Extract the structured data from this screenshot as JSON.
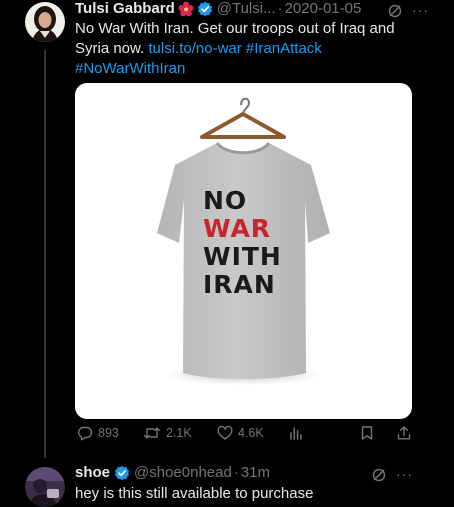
{
  "tweet": {
    "author_name": "Tulsi Gabbard",
    "author_handle": "@Tulsi...",
    "date_sep": "·",
    "date": "2020-01-05",
    "text_line1": "No War With Iran. Get our troops out of Iraq and",
    "text_line2_prefix": "Syria now.",
    "link": "tulsi.to/no-war",
    "hashtag1": "#IranAttack",
    "hashtag2": "#NoWarWithIran",
    "more": "···",
    "shirt_text": [
      "NO",
      "WAR",
      "WITH",
      "IRAN"
    ],
    "actions": {
      "replies": "893",
      "retweets": "2.1K",
      "likes": "4.6K"
    }
  },
  "reply": {
    "author_name": "shoe",
    "author_handle": "@shoe0nhead",
    "time_sep": "·",
    "time": "31m",
    "text": "hey is this still available to purchase",
    "more": "···"
  },
  "colors": {
    "background": "#000000",
    "text": "#e7e9ea",
    "muted": "#71767b",
    "link": "#1d9bf0",
    "verified": "#1d9bf0",
    "shirt_red": "#c8242b"
  }
}
